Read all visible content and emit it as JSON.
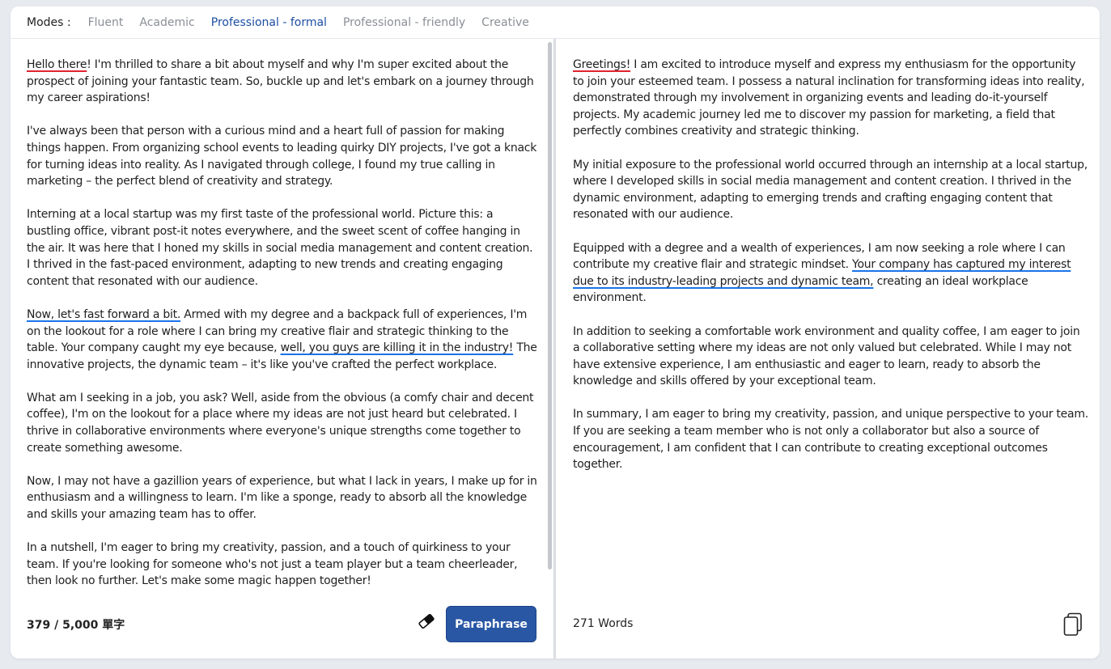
{
  "modes": {
    "label": "Modes :",
    "items": [
      {
        "label": "Fluent",
        "active": false
      },
      {
        "label": "Academic",
        "active": false
      },
      {
        "label": "Professional - formal",
        "active": true
      },
      {
        "label": "Professional - friendly",
        "active": false
      },
      {
        "label": "Creative",
        "active": false
      }
    ]
  },
  "input": {
    "p1": {
      "u": "Hello there",
      "rest": "! I'm thrilled to share a bit about myself and why I'm super excited about the prospect of joining your fantastic team. So, buckle up and let's embark on a journey through my career aspirations!"
    },
    "p2": "I've always been that person with a curious mind and a heart full of passion for making things happen. From organizing school events to leading quirky DIY projects, I've got a knack for turning ideas into reality. As I navigated through college, I found my true calling in marketing – the perfect blend of creativity and strategy.",
    "p3": "Interning at a local startup was my first taste of the professional world. Picture this: a bustling office, vibrant post-it notes everywhere, and the sweet scent of coffee hanging in the air. It was here that I honed my skills in social media management and content creation. I thrived in the fast-paced environment, adapting to new trends and creating engaging content that resonated with our audience.",
    "p4": {
      "u1": "Now, let's fast forward a bit.",
      "mid": " Armed with my degree and a backpack full of experiences, I'm on the lookout for a role where I can bring my creative flair and strategic thinking to the table. Your company caught my eye because, ",
      "u2": "well, you guys are killing it in the industry!",
      "rest": " The innovative projects, the dynamic team – it's like you've crafted the perfect workplace."
    },
    "p5": "What am I seeking in a job, you ask? Well, aside from the obvious (a comfy chair and decent coffee), I'm on the lookout for a place where my ideas are not just heard but celebrated. I thrive in collaborative environments where everyone's unique strengths come together to create something awesome.",
    "p6": "Now, I may not have a gazillion years of experience, but what I lack in years, I make up for in enthusiasm and a willingness to learn. I'm like a sponge, ready to absorb all the knowledge and skills your amazing team has to offer.",
    "p7": "In a nutshell, I'm eager to bring my creativity, passion, and a touch of quirkiness to your team. If you're looking for someone who's not just a team player but a team cheerleader, then look no further. Let's make some magic happen together!",
    "word_count": "379 / 5,000 單字",
    "eraser_icon": "eraser-icon",
    "paraphrase_label": "Paraphrase"
  },
  "output": {
    "p1": {
      "u": "Greetings!",
      "rest": " I am excited to introduce myself and express my enthusiasm for the opportunity to join your esteemed team. I possess a natural inclination for transforming ideas into reality, demonstrated through my involvement in organizing events and leading do-it-yourself projects. My academic journey led me to discover my passion for marketing, a field that perfectly combines creativity and strategic thinking."
    },
    "p2": "My initial exposure to the professional world occurred through an internship at a local startup, where I developed skills in social media management and content creation. I thrived in the dynamic environment, adapting to emerging trends and crafting engaging content that resonated with our audience.",
    "p3": {
      "pre": "Equipped with a degree and a wealth of experiences, I am now seeking a role where I can contribute my creative flair and strategic mindset. ",
      "u": "Your company has captured my interest due to its industry-leading projects and dynamic team,",
      "rest": " creating an ideal workplace environment."
    },
    "p4": "In addition to seeking a comfortable work environment and quality coffee, I am eager to join a collaborative setting where my ideas are not only valued but celebrated. While I may not have extensive experience, I am enthusiastic and eager to learn, ready to absorb the knowledge and skills offered by your exceptional team.",
    "p5": "In summary, I am eager to bring my creativity, passion, and unique perspective to your team. If you are seeking a team member who is not only a collaborator but also a source of encouragement, I am confident that I can contribute to creating exceptional outcomes together.",
    "word_count": "271 Words",
    "copy_icon": "copy-icon"
  },
  "colors": {
    "accent": "#2957a4",
    "active_mode": "#1c4ea3",
    "underline_red": "#e0242e",
    "underline_blue": "#1a73e8"
  }
}
